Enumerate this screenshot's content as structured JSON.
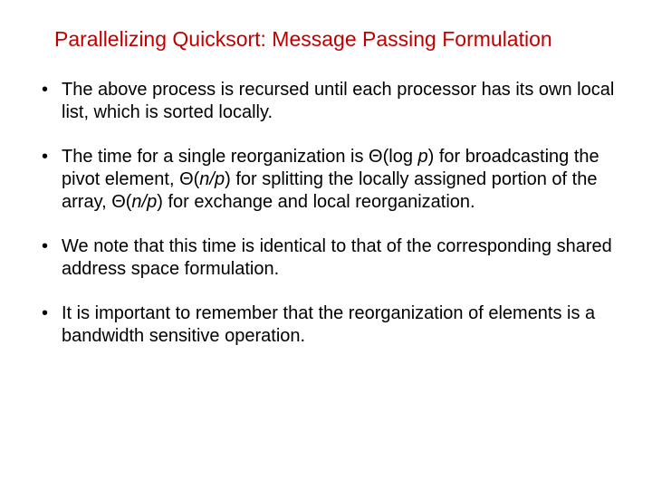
{
  "slide": {
    "title": "Parallelizing Quicksort: Message Passing Formulation",
    "bullets": [
      {
        "parts": [
          {
            "text": "The above process is recursed until each processor has its own local list, which is sorted locally.",
            "italic": false
          }
        ]
      },
      {
        "parts": [
          {
            "text": "The time for a single reorganization is Θ(log ",
            "italic": false
          },
          {
            "text": "p",
            "italic": true
          },
          {
            "text": ") for broadcasting the pivot element, Θ(",
            "italic": false
          },
          {
            "text": "n/p",
            "italic": true
          },
          {
            "text": ") for splitting the locally assigned portion of the array, Θ(",
            "italic": false
          },
          {
            "text": "n/p",
            "italic": true
          },
          {
            "text": ") for exchange and local reorganization.",
            "italic": false
          }
        ]
      },
      {
        "parts": [
          {
            "text": "We note that this time is identical to that of the corresponding shared address space formulation.",
            "italic": false
          }
        ]
      },
      {
        "parts": [
          {
            "text": "It is important to remember that the reorganization of elements is a bandwidth sensitive operation.",
            "italic": false
          }
        ]
      }
    ]
  }
}
